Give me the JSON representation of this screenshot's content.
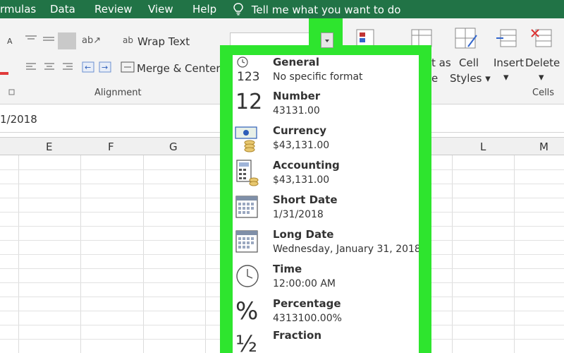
{
  "menu": [
    "rmulas",
    "Data",
    "Review",
    "View",
    "Help"
  ],
  "tell_me": "Tell me what you want to do",
  "ribbon": {
    "wrap_text": "Wrap Text",
    "merge_center": "Merge & Center",
    "alignment_label": "Alignment",
    "format_as_partial": "t as",
    "format_as_partial2": "e",
    "cell_styles_line1": "Cell",
    "cell_styles_line2": "Styles",
    "insert_label": "Insert",
    "delete_label": "Delete",
    "cells_label": "Cells"
  },
  "formula_bar": {
    "value": "1/2018"
  },
  "columns": [
    "E",
    "F",
    "G",
    "L",
    "M"
  ],
  "formats": [
    {
      "name": "General",
      "sample": "No specific format",
      "icon": "general-123-icon",
      "glyph": "123"
    },
    {
      "name": "Number",
      "sample": "43131.00",
      "icon": "number-12-icon",
      "glyph": "12"
    },
    {
      "name": "Currency",
      "sample": "$43,131.00",
      "icon": "currency-money-icon"
    },
    {
      "name": "Accounting",
      "sample": " $43,131.00",
      "icon": "accounting-calculator-icon"
    },
    {
      "name": "Short Date",
      "sample": "1/31/2018",
      "icon": "short-date-calendar-icon"
    },
    {
      "name": "Long Date",
      "sample": "Wednesday, January 31, 2018",
      "icon": "long-date-calendar-icon"
    },
    {
      "name": "Time",
      "sample": "12:00:00 AM",
      "icon": "time-clock-icon"
    },
    {
      "name": "Percentage",
      "sample": "4313100.00%",
      "icon": "percentage-icon",
      "glyph": "%"
    },
    {
      "name": "Fraction",
      "sample": "",
      "icon": "fraction-icon",
      "glyph": "½"
    }
  ],
  "colors": {
    "excel_green": "#217346",
    "highlight_green": "#2ee52e"
  }
}
